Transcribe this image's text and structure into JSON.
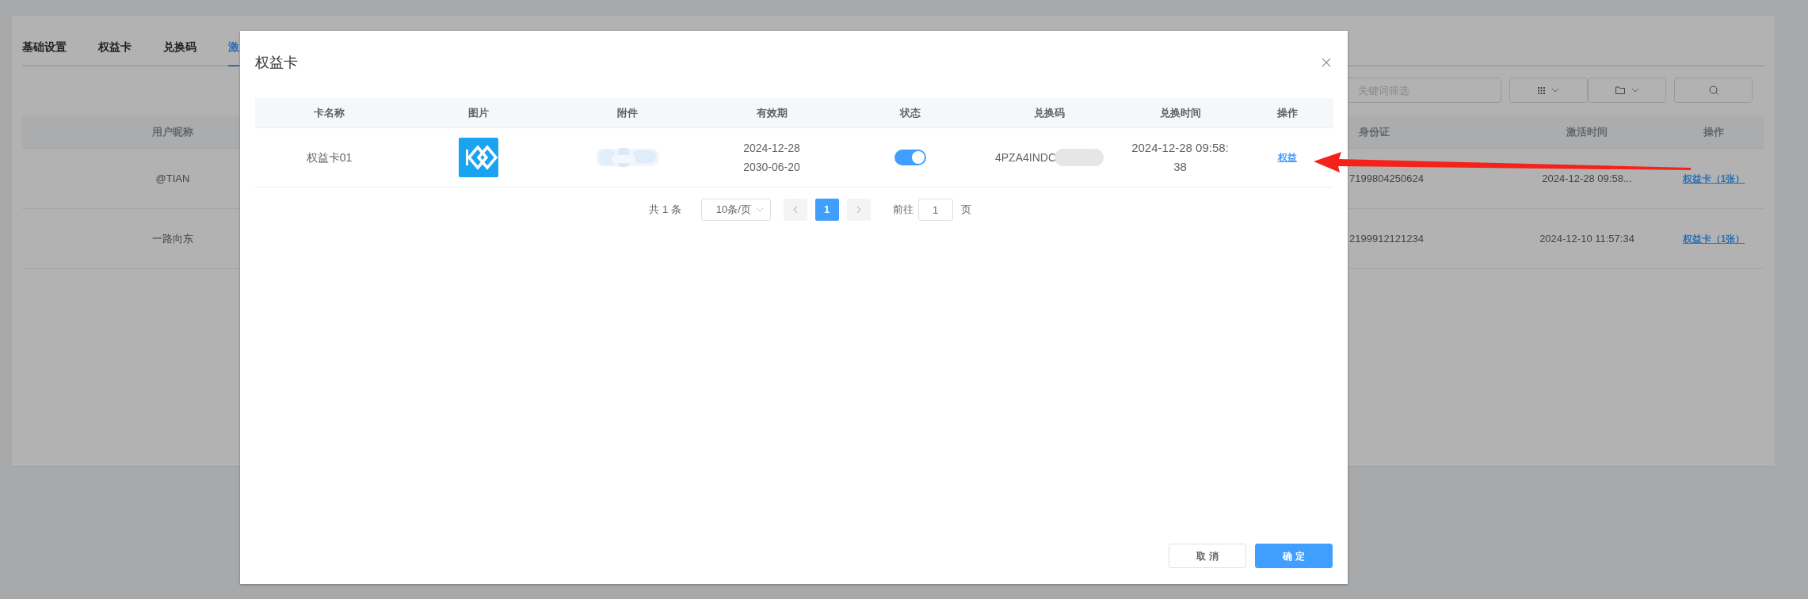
{
  "background_page": {
    "tabs": [
      {
        "label": "基础设置",
        "selected": false
      },
      {
        "label": "权益卡",
        "selected": false
      },
      {
        "label": "兑换码",
        "selected": false
      },
      {
        "label": "激",
        "selected": true
      }
    ],
    "search": {
      "placeholder": "关键词筛选"
    },
    "table": {
      "columns": [
        "用户昵称",
        "身份证",
        "激活时间",
        "操作"
      ],
      "rows": [
        {
          "nickname": "@TIAN",
          "id_number": "7199804250624",
          "activated_at": "2024-12-28 09:58...",
          "action": "权益卡（1张）"
        },
        {
          "nickname": "一路向东",
          "id_number": "2199912121234",
          "activated_at": "2024-12-10 11:57:34",
          "action": "权益卡（1张）"
        }
      ]
    }
  },
  "dialog": {
    "title": "权益卡",
    "table": {
      "columns": [
        "卡名称",
        "图片",
        "附件",
        "有效期",
        "状态",
        "兑换码",
        "兑换时间",
        "操作"
      ],
      "rows": [
        {
          "card_name": "权益卡01",
          "valid_from": "2024-12-28",
          "valid_to": "2030-06-20",
          "status_on": true,
          "redeem_code": "4PZA4INDC",
          "redeemed_at": "2024-12-28 09:58:38",
          "action": "权益"
        }
      ]
    },
    "pagination": {
      "total": "共 1 条",
      "page_size": "10条/页",
      "pages": [
        {
          "label": "1",
          "selected": true
        }
      ],
      "goto_label": "前往",
      "goto_value": "1",
      "page_suffix": "页"
    },
    "buttons": [
      {
        "label": "取 消",
        "kind": "default"
      },
      {
        "label": "确 定",
        "kind": "primary"
      }
    ]
  }
}
